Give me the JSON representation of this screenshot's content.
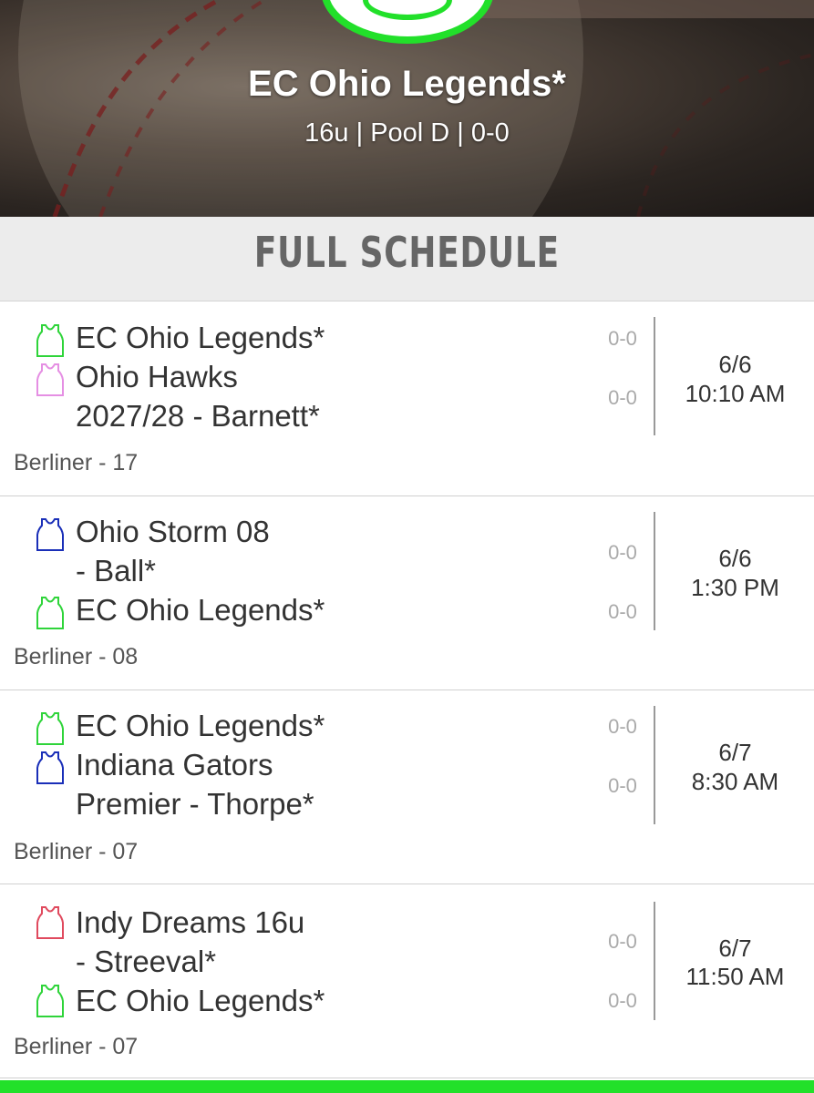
{
  "team_header": {
    "name": "EC Ohio Legends*",
    "details": "16u | Pool D | 0-0"
  },
  "schedule_title": "FULL SCHEDULE",
  "colors": {
    "accent": "#22e02a",
    "header_bg": "#ececec",
    "text": "#333333",
    "score": "#aaaaaa"
  },
  "games": [
    {
      "team1": {
        "name": "EC Ohio Legends*",
        "jersey_icon": "green-jersey-icon",
        "color": "#2fd43a",
        "score": "0-0"
      },
      "team2": {
        "name": "Ohio Hawks\n2027/28 - Barnett*",
        "jersey_icon": "pink-jersey-icon",
        "color": "#e58fe3",
        "score": "0-0"
      },
      "date": "6/6",
      "time": "10:10 AM",
      "venue": "Berliner - 17"
    },
    {
      "team1": {
        "name": "Ohio Storm 08\n- Ball*",
        "jersey_icon": "blue-jersey-icon",
        "color": "#1a2fb8",
        "score": "0-0"
      },
      "team2": {
        "name": "EC Ohio Legends*",
        "jersey_icon": "green-jersey-icon",
        "color": "#2fd43a",
        "score": "0-0"
      },
      "date": "6/6",
      "time": "1:30 PM",
      "venue": "Berliner - 08"
    },
    {
      "team1": {
        "name": "EC Ohio Legends*",
        "jersey_icon": "green-jersey-icon",
        "color": "#2fd43a",
        "score": "0-0"
      },
      "team2": {
        "name": "Indiana Gators\nPremier - Thorpe*",
        "jersey_icon": "blue-jersey-icon",
        "color": "#1a2fb8",
        "score": "0-0"
      },
      "date": "6/7",
      "time": "8:30 AM",
      "venue": "Berliner - 07"
    },
    {
      "team1": {
        "name": "Indy Dreams 16u\n- Streeval*",
        "jersey_icon": "red-jersey-icon",
        "color": "#e04a5e",
        "score": "0-0"
      },
      "team2": {
        "name": "EC Ohio Legends*",
        "jersey_icon": "green-jersey-icon",
        "color": "#2fd43a",
        "score": "0-0"
      },
      "date": "6/7",
      "time": "11:50 AM",
      "venue": "Berliner - 07"
    }
  ]
}
